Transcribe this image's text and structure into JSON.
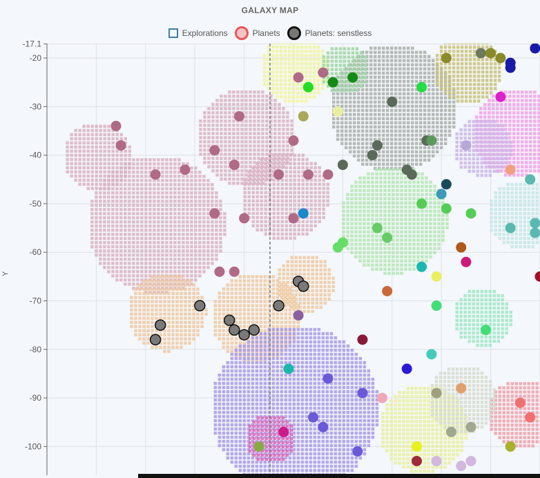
{
  "chart_data": {
    "type": "scatter",
    "title": "GALAXY MAP",
    "ylabel": "Y",
    "xlabel": "",
    "ylim": [
      -104,
      -17.1
    ],
    "y_ticks": [
      "-17.1",
      "-20",
      "-30",
      "-40",
      "-50",
      "-60",
      "-70",
      "-80",
      "-90",
      "-100"
    ],
    "grid": true,
    "legend_position": "top",
    "legend": [
      "Explorations",
      "Planets",
      "Planets: senstless"
    ],
    "regions": [
      {
        "color": "#d9b3c2",
        "x": 22,
        "y": -54,
        "r": 14
      },
      {
        "color": "#d9b3c2",
        "x": 10,
        "y": -40,
        "r": 7
      },
      {
        "color": "#d9b3c2",
        "x": 40,
        "y": -36,
        "r": 10
      },
      {
        "color": "#d9b3c2",
        "x": 48,
        "y": -48,
        "r": 9
      },
      {
        "color": "#f0c9a0",
        "x": 24,
        "y": -72,
        "r": 8
      },
      {
        "color": "#f0c9a0",
        "x": 42,
        "y": -73,
        "r": 9
      },
      {
        "color": "#f0c9a0",
        "x": 52,
        "y": -66,
        "r": 6
      },
      {
        "color": "#aab0ab",
        "x": 70,
        "y": -30,
        "r": 13
      },
      {
        "color": "#b3e6b3",
        "x": 70,
        "y": -53,
        "r": 11
      },
      {
        "color": "#a89ae8",
        "x": 50,
        "y": -92,
        "r": 17
      },
      {
        "color": "#9ee8c6",
        "x": 88,
        "y": -73,
        "r": 6
      },
      {
        "color": "#f2a0e6",
        "x": 95,
        "y": -35,
        "r": 9
      },
      {
        "color": "#c6e6e6",
        "x": 96,
        "y": -52,
        "r": 7
      },
      {
        "color": "#c9b6e6",
        "x": 88,
        "y": -38,
        "r": 6
      },
      {
        "color": "#c9c27a",
        "x": 85,
        "y": -22,
        "r": 7
      },
      {
        "color": "#f0f59a",
        "x": 50,
        "y": -22,
        "r": 7
      },
      {
        "color": "#9ed6a3",
        "x": 60,
        "y": -22,
        "r": 5
      },
      {
        "color": "#f0a0a8",
        "x": 96,
        "y": -93,
        "r": 7
      },
      {
        "color": "#e8f09a",
        "x": 76,
        "y": -96,
        "r": 9
      },
      {
        "color": "#d6dccf",
        "x": 84,
        "y": -90,
        "r": 7
      },
      {
        "color": "#e066b3",
        "x": 45,
        "y": -98,
        "r": 5
      }
    ],
    "series": [
      {
        "name": "Planets",
        "points": [
          {
            "x": 14,
            "y": -34,
            "color": "#b06a86"
          },
          {
            "x": 15,
            "y": -38,
            "color": "#b06a86"
          },
          {
            "x": 22,
            "y": -44,
            "color": "#b06a86"
          },
          {
            "x": 28,
            "y": -43,
            "color": "#b06a86"
          },
          {
            "x": 34,
            "y": -39,
            "color": "#b06a86"
          },
          {
            "x": 39,
            "y": -32,
            "color": "#b06a86"
          },
          {
            "x": 38,
            "y": -42,
            "color": "#b06a86"
          },
          {
            "x": 34,
            "y": -52,
            "color": "#b06a86"
          },
          {
            "x": 40,
            "y": -53,
            "color": "#b06a86"
          },
          {
            "x": 35,
            "y": -64,
            "color": "#b06a86"
          },
          {
            "x": 38,
            "y": -64,
            "color": "#b06a86"
          },
          {
            "x": 47,
            "y": -44,
            "color": "#b06a86"
          },
          {
            "x": 50,
            "y": -37,
            "color": "#b06a86"
          },
          {
            "x": 51,
            "y": -24,
            "color": "#b06a86"
          },
          {
            "x": 53,
            "y": -44,
            "color": "#b06a86"
          },
          {
            "x": 50,
            "y": -53,
            "color": "#b06a86"
          },
          {
            "x": 56,
            "y": -23,
            "color": "#b06a86"
          },
          {
            "x": 57,
            "y": -44,
            "color": "#b06a86"
          },
          {
            "x": 51,
            "y": -73,
            "color": "#8a5fa0"
          },
          {
            "x": 53,
            "y": -26,
            "color": "#22dd22"
          },
          {
            "x": 58,
            "y": -25,
            "color": "#168a16"
          },
          {
            "x": 62,
            "y": -24,
            "color": "#168a16"
          },
          {
            "x": 52,
            "y": -32,
            "color": "#a8a858"
          },
          {
            "x": 59,
            "y": -31,
            "color": "#e8f0a0"
          },
          {
            "x": 60,
            "y": -42,
            "color": "#5a6a5a"
          },
          {
            "x": 70,
            "y": -29,
            "color": "#5a6a5a"
          },
          {
            "x": 67,
            "y": -38,
            "color": "#5a6a5a"
          },
          {
            "x": 66,
            "y": -40,
            "color": "#5a6a5a"
          },
          {
            "x": 73,
            "y": -43,
            "color": "#5a6a5a"
          },
          {
            "x": 74,
            "y": -44,
            "color": "#5a6a5a"
          },
          {
            "x": 77,
            "y": -37,
            "color": "#5a6a5a"
          },
          {
            "x": 78,
            "y": -37,
            "color": "#5a9a5a"
          },
          {
            "x": 76,
            "y": -26,
            "color": "#22dd44"
          },
          {
            "x": 81,
            "y": -20,
            "color": "#8a8a2a"
          },
          {
            "x": 88,
            "y": -19,
            "color": "#6a7a5a"
          },
          {
            "x": 90,
            "y": -19,
            "color": "#8a8a2a"
          },
          {
            "x": 92,
            "y": -20,
            "color": "#8a8a2a"
          },
          {
            "x": 94,
            "y": -21,
            "color": "#1a1aa8"
          },
          {
            "x": 94,
            "y": -22,
            "color": "#1a1aa8"
          },
          {
            "x": 99,
            "y": -18,
            "color": "#1a1aa8"
          },
          {
            "x": 92,
            "y": -28,
            "color": "#dd22cc"
          },
          {
            "x": 85,
            "y": -38,
            "color": "#b8a8d8"
          },
          {
            "x": 94,
            "y": -43,
            "color": "#f0a080"
          },
          {
            "x": 98,
            "y": -45,
            "color": "#5ab8b0"
          },
          {
            "x": 81,
            "y": -46,
            "color": "#184a5a"
          },
          {
            "x": 80,
            "y": -48,
            "color": "#3a9ab8"
          },
          {
            "x": 76,
            "y": -50,
            "color": "#55cc55"
          },
          {
            "x": 81,
            "y": -51,
            "color": "#55cc55"
          },
          {
            "x": 86,
            "y": -52,
            "color": "#55cc55"
          },
          {
            "x": 67,
            "y": -55,
            "color": "#66cc66"
          },
          {
            "x": 69,
            "y": -57,
            "color": "#66cc66"
          },
          {
            "x": 60,
            "y": -58,
            "color": "#66dd66"
          },
          {
            "x": 59,
            "y": -59,
            "color": "#66dd66"
          },
          {
            "x": 52,
            "y": -52,
            "color": "#1a88cc"
          },
          {
            "x": 94,
            "y": -55,
            "color": "#5ab8b0"
          },
          {
            "x": 99,
            "y": -54,
            "color": "#5ab8b0"
          },
          {
            "x": 99,
            "y": -56,
            "color": "#5ab8b0"
          },
          {
            "x": 84,
            "y": -59,
            "color": "#b05a1a"
          },
          {
            "x": 85,
            "y": -62,
            "color": "#cc1a7a"
          },
          {
            "x": 76,
            "y": -63,
            "color": "#1ab8b0"
          },
          {
            "x": 79,
            "y": -65,
            "color": "#e8f060"
          },
          {
            "x": 100,
            "y": -65,
            "color": "#a0102a"
          },
          {
            "x": 69,
            "y": -68,
            "color": "#c86a3a"
          },
          {
            "x": 79,
            "y": -71,
            "color": "#44dd77"
          },
          {
            "x": 89,
            "y": -76,
            "color": "#44dd77"
          },
          {
            "x": 64,
            "y": -78,
            "color": "#8a1a3a"
          },
          {
            "x": 73,
            "y": -84,
            "color": "#2a1ad8"
          },
          {
            "x": 78,
            "y": -81,
            "color": "#44ccbb"
          },
          {
            "x": 49,
            "y": -84,
            "color": "#1ab8aa"
          },
          {
            "x": 57,
            "y": -86,
            "color": "#6a5ad8"
          },
          {
            "x": 64,
            "y": -89,
            "color": "#6a5ad8"
          },
          {
            "x": 68,
            "y": -90,
            "color": "#f0a8b8"
          },
          {
            "x": 79,
            "y": -89,
            "color": "#a0a080"
          },
          {
            "x": 84,
            "y": -88,
            "color": "#e0a070"
          },
          {
            "x": 96,
            "y": -91,
            "color": "#f07070"
          },
          {
            "x": 98,
            "y": -94,
            "color": "#f07070"
          },
          {
            "x": 54,
            "y": -94,
            "color": "#6a5ad8"
          },
          {
            "x": 56,
            "y": -96,
            "color": "#6a5ad8"
          },
          {
            "x": 48,
            "y": -97,
            "color": "#cc1a88"
          },
          {
            "x": 43,
            "y": -100,
            "color": "#88aa44"
          },
          {
            "x": 63,
            "y": -101,
            "color": "#6a5ad8"
          },
          {
            "x": 82,
            "y": -97,
            "color": "#a0a890"
          },
          {
            "x": 86,
            "y": -96,
            "color": "#a0a890"
          },
          {
            "x": 75,
            "y": -100,
            "color": "#e8f020"
          },
          {
            "x": 94,
            "y": -100,
            "color": "#a8b030"
          },
          {
            "x": 75,
            "y": -103,
            "color": "#a02a3a"
          },
          {
            "x": 79,
            "y": -103,
            "color": "#d0b8e0"
          },
          {
            "x": 84,
            "y": -104,
            "color": "#d0b8e0"
          },
          {
            "x": 86,
            "y": -103,
            "color": "#d0b8e0"
          }
        ]
      },
      {
        "name": "Planets: senstless",
        "points": [
          {
            "x": 23,
            "y": -75
          },
          {
            "x": 22,
            "y": -78
          },
          {
            "x": 31,
            "y": -71
          },
          {
            "x": 37,
            "y": -74
          },
          {
            "x": 38,
            "y": -76
          },
          {
            "x": 40,
            "y": -77
          },
          {
            "x": 42,
            "y": -76
          },
          {
            "x": 47,
            "y": -71
          },
          {
            "x": 51,
            "y": -66
          },
          {
            "x": 52,
            "y": -67
          }
        ]
      }
    ]
  }
}
